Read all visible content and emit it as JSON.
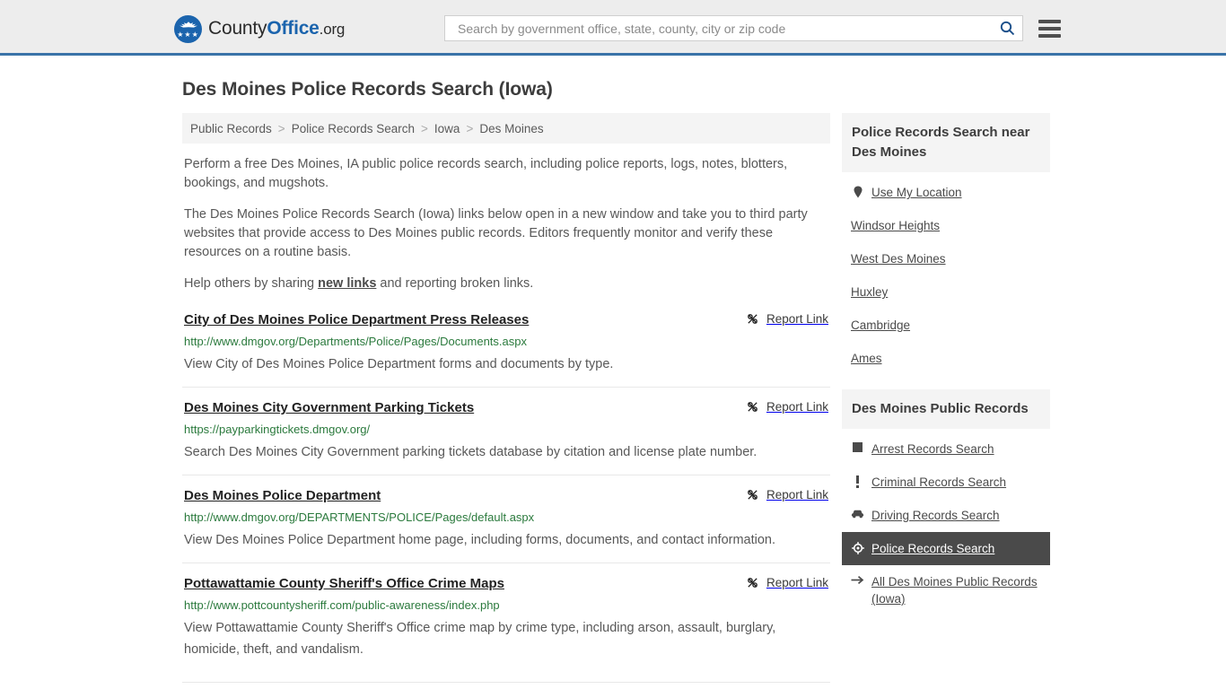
{
  "header": {
    "logo": {
      "part1": "County",
      "part2": "Office",
      "part3": ".org",
      "icon": "eagle-badge-icon"
    },
    "search": {
      "placeholder": "Search by government office, state, county, city or zip code",
      "value": "",
      "button_icon": "search-icon"
    },
    "menu_icon": "hamburger-menu-icon",
    "accent_color": "#3a73a8"
  },
  "page": {
    "title": "Des Moines Police Records Search (Iowa)"
  },
  "breadcrumb": {
    "separator": ">",
    "items": [
      {
        "label": "Public Records"
      },
      {
        "label": "Police Records Search"
      },
      {
        "label": "Iowa"
      },
      {
        "label": "Des Moines"
      }
    ]
  },
  "intro": {
    "p1": "Perform a free Des Moines, IA public police records search, including police reports, logs, notes, blotters, bookings, and mugshots.",
    "p2": "The Des Moines Police Records Search (Iowa) links below open in a new window and take you to third party websites that provide access to Des Moines public records. Editors frequently monitor and verify these resources on a routine basis.",
    "p3_before": "Help others by sharing ",
    "p3_link": "new links",
    "p3_after": " and reporting broken links."
  },
  "results": {
    "report_label": "Report Link",
    "report_icon": "broken-link-icon",
    "items": [
      {
        "title": "City of Des Moines Police Department Press Releases",
        "url": "http://www.dmgov.org/Departments/Police/Pages/Documents.aspx",
        "description": "View City of Des Moines Police Department forms and documents by type."
      },
      {
        "title": "Des Moines City Government Parking Tickets",
        "url": "https://payparkingtickets.dmgov.org/",
        "description": "Search Des Moines City Government parking tickets database by citation and license plate number."
      },
      {
        "title": "Des Moines Police Department",
        "url": "http://www.dmgov.org/DEPARTMENTS/POLICE/Pages/default.aspx",
        "description": "View Des Moines Police Department home page, including forms, documents, and contact information."
      },
      {
        "title": "Pottawattamie County Sheriff's Office Crime Maps",
        "url": "http://www.pottcountysheriff.com/public-awareness/index.php",
        "description": "View Pottawattamie County Sheriff's Office crime map by crime type, including arson, assault, burglary, homicide, theft, and vandalism."
      }
    ]
  },
  "sidebar": {
    "nearby": {
      "heading": "Police Records Search near Des Moines",
      "items": [
        {
          "label": "Use My Location",
          "icon": "map-pin-icon"
        },
        {
          "label": "Windsor Heights",
          "icon": ""
        },
        {
          "label": "West Des Moines",
          "icon": ""
        },
        {
          "label": "Huxley",
          "icon": ""
        },
        {
          "label": "Cambridge",
          "icon": ""
        },
        {
          "label": "Ames",
          "icon": ""
        }
      ]
    },
    "public_records": {
      "heading": "Des Moines Public Records",
      "active_color": "#4a4a4a",
      "items": [
        {
          "label": "Arrest Records Search",
          "icon": "square-icon",
          "active": false
        },
        {
          "label": "Criminal Records Search",
          "icon": "exclamation-icon",
          "active": false
        },
        {
          "label": "Driving Records Search",
          "icon": "car-icon",
          "active": false
        },
        {
          "label": "Police Records Search",
          "icon": "target-icon",
          "active": true
        },
        {
          "label": "All Des Moines Public Records (Iowa)",
          "icon": "arrow-right-icon",
          "active": false
        }
      ]
    }
  }
}
